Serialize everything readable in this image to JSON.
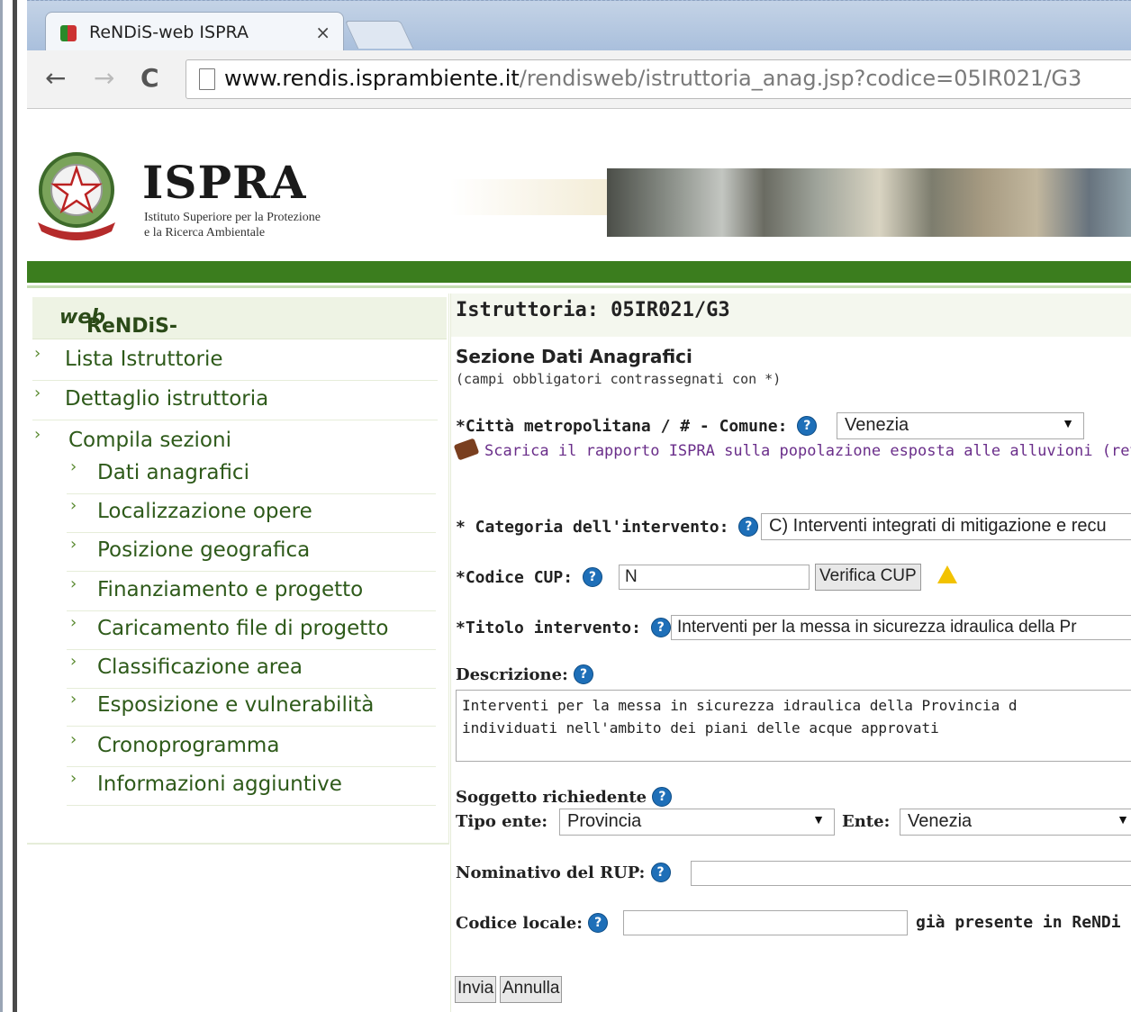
{
  "browser": {
    "tab_title": "ReNDiS-web ISPRA",
    "tab_close": "×",
    "url_host": "www.rendis.isprambiente.it",
    "url_path": "/rendisweb/istruttoria_anag.jsp?codice=05IR021/G3"
  },
  "header": {
    "brand": "ISPRA",
    "brand_sub_line1": "Istituto Superiore per la Protezione",
    "brand_sub_line2": "e la Ricerca Ambientale"
  },
  "sidebar": {
    "title_prefix": "ReNDiS-",
    "title_italic": "web",
    "items": [
      {
        "label": "Lista Istruttorie"
      },
      {
        "label": "Dettaglio istruttoria"
      },
      {
        "label": "Compila sezioni"
      }
    ],
    "subitems": [
      {
        "label": "Dati anagrafici"
      },
      {
        "label": "Localizzazione opere"
      },
      {
        "label": "Posizione geografica"
      },
      {
        "label": "Finanziamento e progetto"
      },
      {
        "label": "Caricamento file di progetto"
      },
      {
        "label": "Classificazione area"
      },
      {
        "label": "Esposizione e vulnerabilità"
      },
      {
        "label": "Cronoprogramma"
      },
      {
        "label": "Informazioni aggiuntive"
      }
    ]
  },
  "main": {
    "istruttoria_title": "Istruttoria: 05IR021/G3",
    "section_title": "Sezione Dati Anagrafici",
    "section_note": "(campi obbligatori contrassegnati con *)",
    "comune_label": "*Città metropolitana / # - Comune:",
    "comune_value": "Venezia",
    "download_link": "Scarica il rapporto ISPRA sulla popolazione esposta alle alluvioni (rev. m",
    "categoria_label": "* Categoria dell'intervento:",
    "categoria_value": "C) Interventi integrati di mitigazione e recu",
    "cup_label": "*Codice CUP:",
    "cup_value": "N",
    "cup_button": "Verifica CUP",
    "titolo_label": "*Titolo intervento:",
    "titolo_value": "Interventi per la messa in sicurezza idraulica della Pr",
    "descrizione_label": "Descrizione:",
    "descrizione_value": "Interventi per la messa in sicurezza idraulica della Provincia d\nindividuati nell'ambito dei piani delle acque approvati",
    "soggetto_label": "Soggetto richiedente",
    "tipo_ente_label": "Tipo ente:",
    "tipo_ente_value": "Provincia",
    "ente_label": "Ente:",
    "ente_value": "Venezia",
    "rup_label": "Nominativo del RUP:",
    "rup_value": "",
    "codice_locale_label": "Codice locale:",
    "codice_locale_value": "",
    "gia_presente": "già presente in ReNDi",
    "invia_button": "Invia",
    "annulla_button": "Annulla",
    "help_glyph": "?"
  },
  "colors": {
    "green_bar": "#3b7d1e",
    "menu_text": "#2e5a1a",
    "help_icon": "#1e6fb8"
  }
}
